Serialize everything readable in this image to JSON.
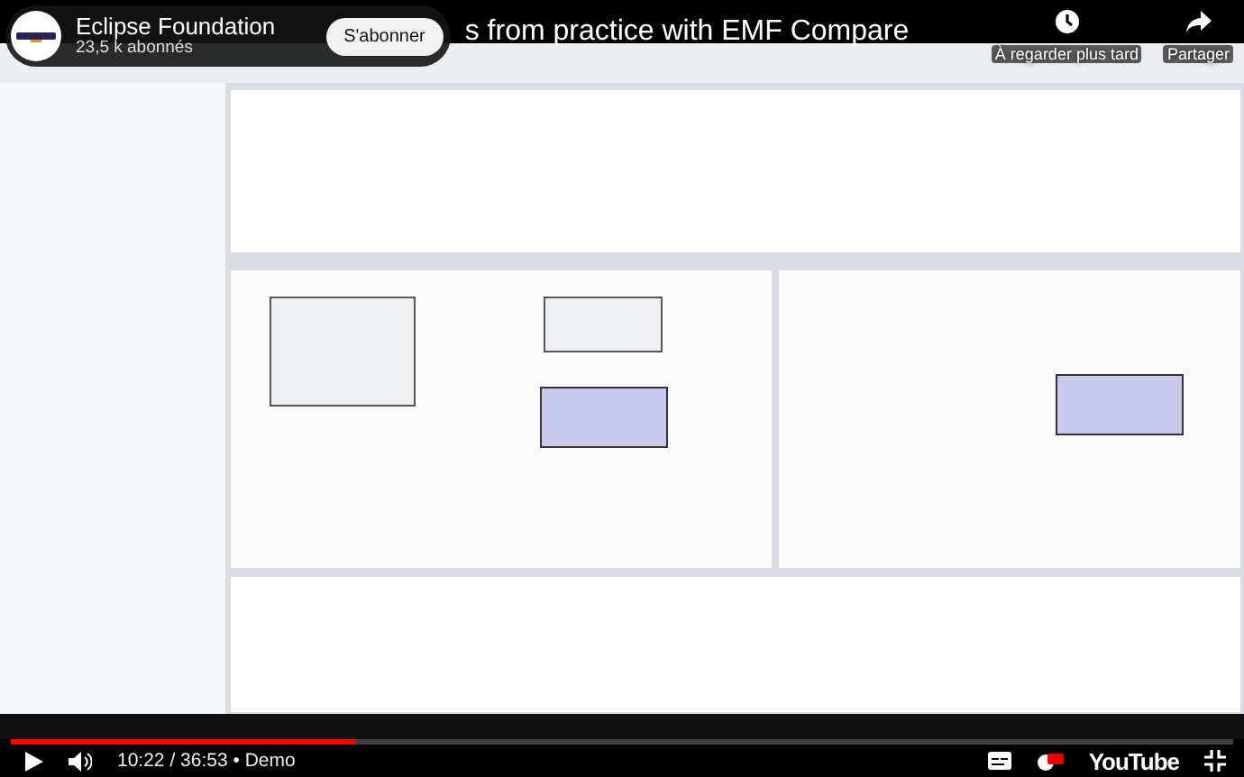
{
  "channel": {
    "name": "Eclipse Foundation",
    "subscribers": "23,5 k abonnés",
    "subscribe_label": "S'abonner"
  },
  "video_title": "s from practice with EMF Compare",
  "top_actions": [
    {
      "kind": "watch-later",
      "label": "À regarder plus tard"
    },
    {
      "kind": "share",
      "label": "Partager"
    }
  ],
  "player": {
    "progress": {
      "level": 0.281
    },
    "time": "10:22 / 36:53",
    "separator": "•",
    "chapter": "Demo",
    "brand": "YouTube"
  }
}
